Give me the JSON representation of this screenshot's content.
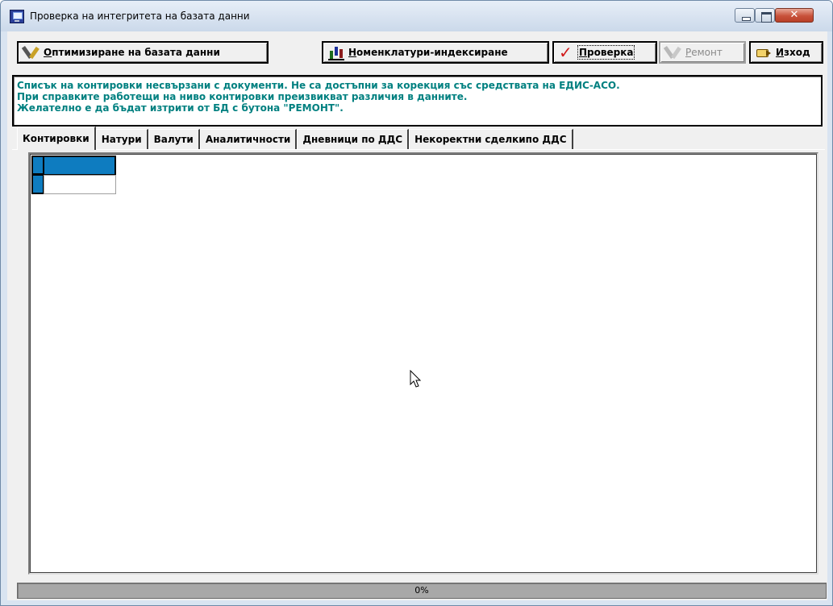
{
  "window": {
    "title": "Проверка на интегритета на базата данни",
    "icon": "database-monitor-icon",
    "controls": {
      "minimize": "minimize-icon",
      "maximize": "maximize-icon",
      "close_label": "✕"
    }
  },
  "toolbar": {
    "optimize_label": "Оптимизиране на базата данни",
    "optimize_icon": "tools-icon",
    "index_label": "Номенклатури-индексиране",
    "index_icon": "bar-chart-icon",
    "check_label": "Проверка",
    "check_icon": "red-check-icon",
    "repair_label": "Ремонт",
    "repair_icon": "tools-disabled-icon",
    "exit_label": "Изход",
    "exit_icon": "pointing-hand-icon"
  },
  "message": {
    "line1": "Списък на контировки несвързани с документи. Не са достъпни за корекция със средствата на ЕДИС-АСО.",
    "line2": "При справките работещи на ниво контировки преизвикват различия в данните.",
    "line3": "Желателно е да бъдат изтрити от БД с бутона \"РЕМОНТ\".",
    "color": "#008080"
  },
  "tabs": [
    {
      "label": "Контировки",
      "active": true
    },
    {
      "label": "Натури",
      "active": false
    },
    {
      "label": "Валути",
      "active": false
    },
    {
      "label": "Аналитичности",
      "active": false
    },
    {
      "label": "Дневници по ДДС",
      "active": false
    },
    {
      "label": "Некоректни сделкипо ДДС",
      "active": false
    }
  ],
  "grid": {
    "rows": [
      {
        "value": "",
        "selected": true
      },
      {
        "value": "",
        "selected": false
      }
    ],
    "selection_color": "#0e7cc0"
  },
  "progress": {
    "value": 0,
    "text": "0%"
  }
}
